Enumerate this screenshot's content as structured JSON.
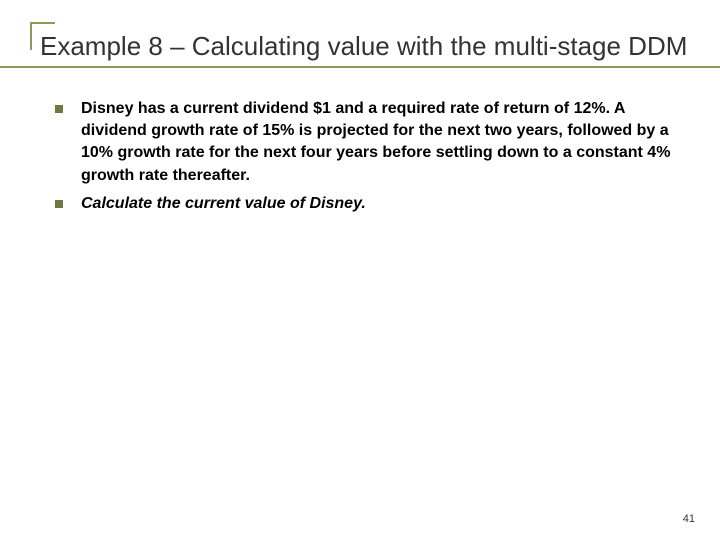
{
  "title": "Example 8 – Calculating value with the multi-stage    DDM",
  "bullets": [
    {
      "text": "Disney has a current dividend $1 and a required rate of return of 12%. A dividend growth rate of 15% is projected for the next two years, followed by a 10% growth rate for the next four years before settling down to a constant 4% growth rate thereafter.",
      "italic": false
    },
    {
      "text": "Calculate the current value of Disney.",
      "italic": true
    }
  ],
  "page_number": "41"
}
